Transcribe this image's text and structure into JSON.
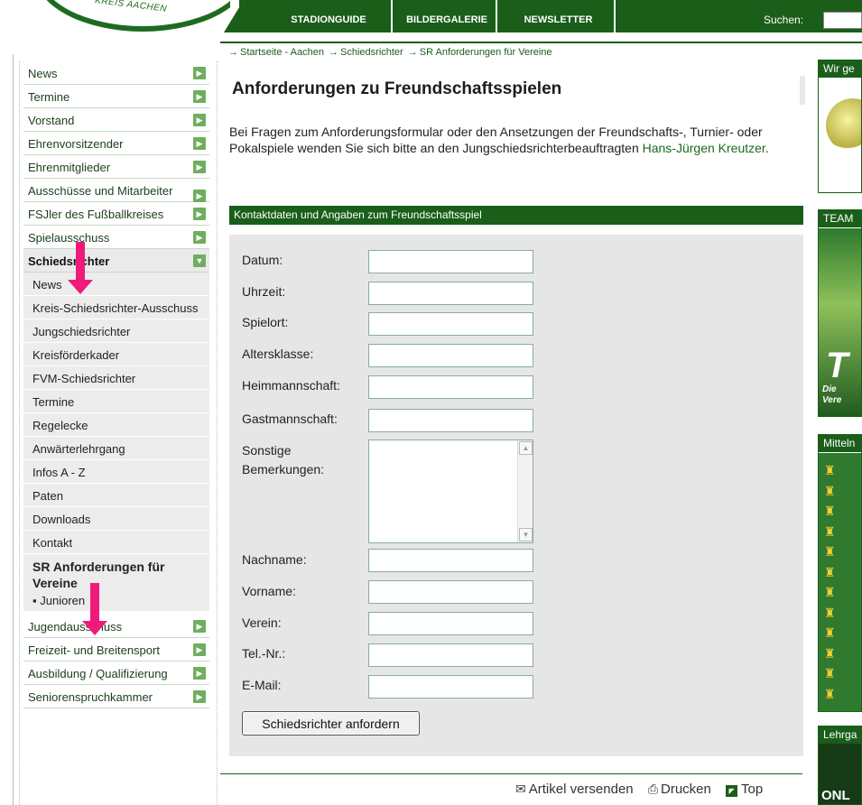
{
  "header": {
    "logo_text": "KREIS AACHEN",
    "nav": [
      "STADIONGUIDE",
      "BILDERGALERIE",
      "NEWSLETTER"
    ],
    "search_label": "Suchen:"
  },
  "breadcrumb": [
    "Startseite - Aachen",
    "Schiedsrichter",
    "SR Anforderungen für Vereine"
  ],
  "sidebar": {
    "items_top": [
      "News",
      "Termine",
      "Vorstand",
      "Ehrenvorsitzender",
      "Ehrenmitglieder",
      "Ausschüsse und Mitarbeiter",
      "FSJler des Fußballkreises",
      "Spielausschuss"
    ],
    "active": "Schiedsrichter",
    "subitems": [
      "News",
      "Kreis-Schiedsrichter-Ausschuss",
      "Jungschiedsrichter",
      "Kreisförderkader",
      "FVM-Schiedsrichter",
      "Termine",
      "Regelecke",
      "Anwärterlehrgang",
      "Infos A - Z",
      "Paten",
      "Downloads",
      "Kontakt"
    ],
    "selected": "SR Anforderungen für Vereine",
    "selected_child": "Junioren",
    "items_bottom": [
      "Jugendausschuss",
      "Freizeit- und Breitensport",
      "Ausbildung / Qualifizierung",
      "Seniorenspruchkammer"
    ]
  },
  "main": {
    "title": "Anforderungen zu Freundschaftsspielen",
    "intro_text": "Bei Fragen zum Anforderungsformular oder den Ansetzungen der Freundschafts-, Turnier- oder Pokalspiele wenden Sie sich bitte an den Jungschiedsrichterbeauftragten ",
    "intro_link": "Hans-Jürgen Kreutzer",
    "intro_end": ".",
    "form_header": "Kontaktdaten und Angaben zum Freundschaftsspiel",
    "fields": {
      "datum": "Datum:",
      "uhrzeit": "Uhrzeit:",
      "spielort": "Spielort:",
      "altersklasse": "Altersklasse:",
      "heimmannschaft": "Heimmannschaft:",
      "gastmannschaft": "Gastmannschaft:",
      "sonstige_1": "Sonstige",
      "sonstige_2": "Bemerkungen:",
      "nachname": "Nachname:",
      "vorname": "Vorname:",
      "verein": "Verein:",
      "tel": "Tel.-Nr.:",
      "email": "E-Mail:"
    },
    "submit_label": "Schiedsrichter anfordern",
    "footer": {
      "send": "Artikel versenden",
      "print": "Drucken",
      "top": "Top"
    }
  },
  "right": {
    "box1_head": "Wir ge",
    "box2_head": "TEAM",
    "box3_head": "Mitteln",
    "box4_head": "Lehrga",
    "box2_big": "T",
    "box2_sub1": "Die",
    "box2_sub2": "Vere",
    "box4_big": "ONL"
  },
  "colors": {
    "brand_green": "#1a5e1a",
    "highlight_arrow": "#ee1b7b"
  }
}
